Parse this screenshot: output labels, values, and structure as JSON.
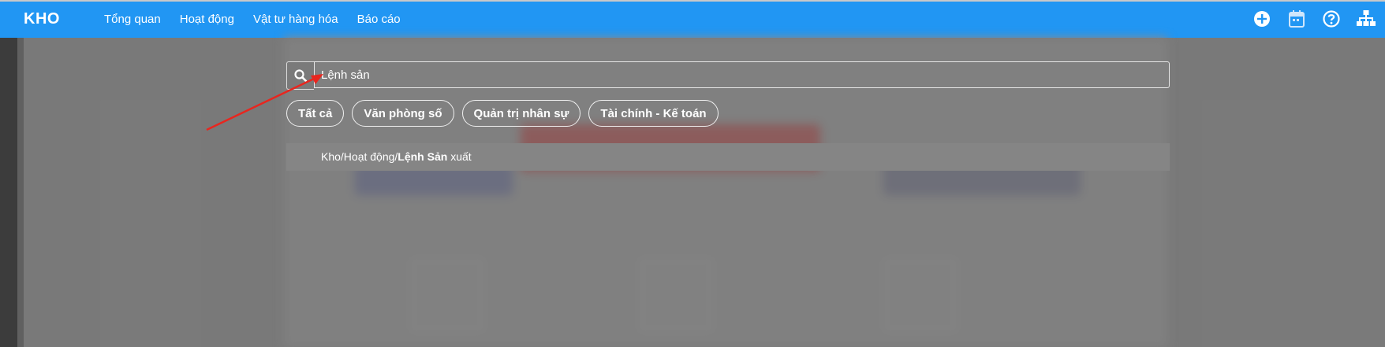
{
  "brand": "KHO",
  "nav": [
    "Tổng quan",
    "Hoạt động",
    "Vật tư hàng hóa",
    "Báo cáo"
  ],
  "tools": [
    "plus-circle-icon",
    "calendar-icon",
    "help-icon",
    "sitemap-icon"
  ],
  "search": {
    "value": "Lệnh sản"
  },
  "chips": [
    "Tất cả",
    "Văn phòng số",
    "Quản trị nhân sự",
    "Tài chính - Kế toán"
  ],
  "result": {
    "prefix": "Kho/Hoạt động/",
    "match": "Lệnh Sản",
    "suffix": " xuất"
  },
  "colors": {
    "topbar": "#2196f3",
    "arrow": "#e8261f"
  }
}
